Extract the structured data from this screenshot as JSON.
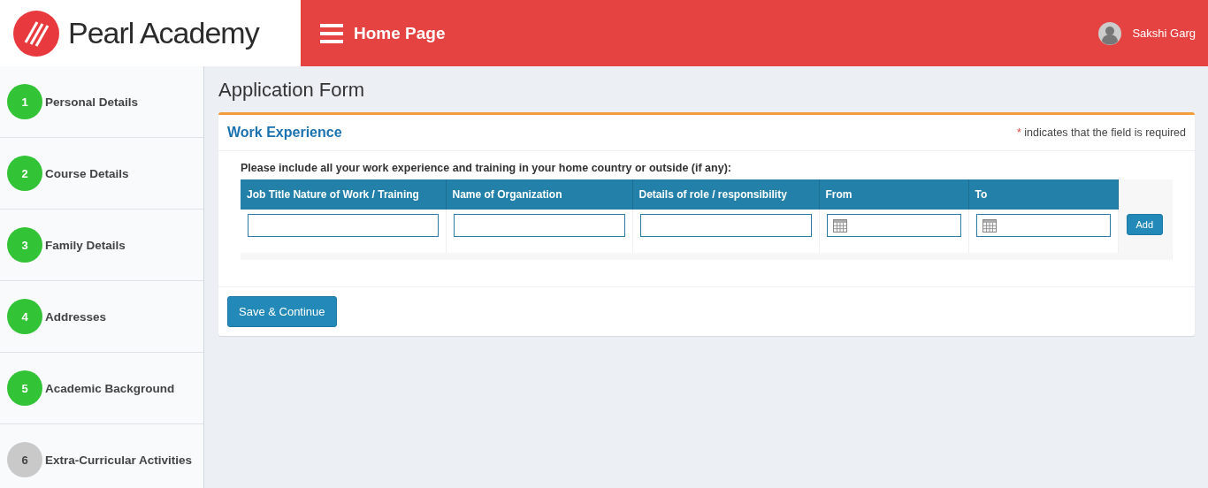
{
  "header": {
    "logo_text": "Pearl Academy",
    "page_title": "Home Page",
    "user_name": "Sakshi Garg"
  },
  "sidebar": {
    "steps": [
      {
        "number": "1",
        "label": "Personal Details",
        "completed": true
      },
      {
        "number": "2",
        "label": "Course Details",
        "completed": true
      },
      {
        "number": "3",
        "label": "Family Details",
        "completed": true
      },
      {
        "number": "4",
        "label": "Addresses",
        "completed": true
      },
      {
        "number": "5",
        "label": "Academic Background",
        "completed": true
      },
      {
        "number": "6",
        "label": "Extra-Curricular Activities",
        "completed": false
      }
    ]
  },
  "page_heading": "Application Form",
  "card": {
    "title": "Work Experience",
    "required_mark": "*",
    "required_note": "indicates that the field is required",
    "instruction": "Please include all your work experience and training in your home country or outside (if any):",
    "table": {
      "columns": [
        {
          "header": "Job Title Nature of Work / Training",
          "kind": "text"
        },
        {
          "header": "Name of Organization",
          "kind": "text"
        },
        {
          "header": "Details of role / responsibility",
          "kind": "text"
        },
        {
          "header": "From",
          "kind": "date"
        },
        {
          "header": "To",
          "kind": "date"
        },
        {
          "kind": "button",
          "label": "Add"
        }
      ]
    },
    "submit_label": "Save & Continue"
  }
}
